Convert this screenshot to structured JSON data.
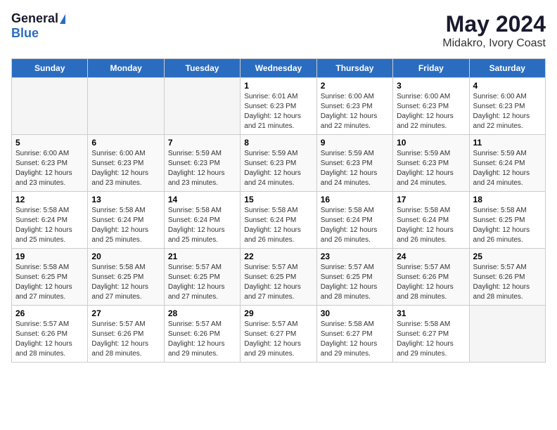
{
  "header": {
    "logo_general": "General",
    "logo_blue": "Blue",
    "title": "May 2024",
    "subtitle": "Midakro, Ivory Coast"
  },
  "columns": [
    "Sunday",
    "Monday",
    "Tuesday",
    "Wednesday",
    "Thursday",
    "Friday",
    "Saturday"
  ],
  "weeks": [
    [
      {
        "day": "",
        "empty": true
      },
      {
        "day": "",
        "empty": true
      },
      {
        "day": "",
        "empty": true
      },
      {
        "day": "1",
        "sunrise": "Sunrise: 6:01 AM",
        "sunset": "Sunset: 6:23 PM",
        "daylight": "Daylight: 12 hours and 21 minutes."
      },
      {
        "day": "2",
        "sunrise": "Sunrise: 6:00 AM",
        "sunset": "Sunset: 6:23 PM",
        "daylight": "Daylight: 12 hours and 22 minutes."
      },
      {
        "day": "3",
        "sunrise": "Sunrise: 6:00 AM",
        "sunset": "Sunset: 6:23 PM",
        "daylight": "Daylight: 12 hours and 22 minutes."
      },
      {
        "day": "4",
        "sunrise": "Sunrise: 6:00 AM",
        "sunset": "Sunset: 6:23 PM",
        "daylight": "Daylight: 12 hours and 22 minutes."
      }
    ],
    [
      {
        "day": "5",
        "sunrise": "Sunrise: 6:00 AM",
        "sunset": "Sunset: 6:23 PM",
        "daylight": "Daylight: 12 hours and 23 minutes."
      },
      {
        "day": "6",
        "sunrise": "Sunrise: 6:00 AM",
        "sunset": "Sunset: 6:23 PM",
        "daylight": "Daylight: 12 hours and 23 minutes."
      },
      {
        "day": "7",
        "sunrise": "Sunrise: 5:59 AM",
        "sunset": "Sunset: 6:23 PM",
        "daylight": "Daylight: 12 hours and 23 minutes."
      },
      {
        "day": "8",
        "sunrise": "Sunrise: 5:59 AM",
        "sunset": "Sunset: 6:23 PM",
        "daylight": "Daylight: 12 hours and 24 minutes."
      },
      {
        "day": "9",
        "sunrise": "Sunrise: 5:59 AM",
        "sunset": "Sunset: 6:23 PM",
        "daylight": "Daylight: 12 hours and 24 minutes."
      },
      {
        "day": "10",
        "sunrise": "Sunrise: 5:59 AM",
        "sunset": "Sunset: 6:23 PM",
        "daylight": "Daylight: 12 hours and 24 minutes."
      },
      {
        "day": "11",
        "sunrise": "Sunrise: 5:59 AM",
        "sunset": "Sunset: 6:24 PM",
        "daylight": "Daylight: 12 hours and 24 minutes."
      }
    ],
    [
      {
        "day": "12",
        "sunrise": "Sunrise: 5:58 AM",
        "sunset": "Sunset: 6:24 PM",
        "daylight": "Daylight: 12 hours and 25 minutes."
      },
      {
        "day": "13",
        "sunrise": "Sunrise: 5:58 AM",
        "sunset": "Sunset: 6:24 PM",
        "daylight": "Daylight: 12 hours and 25 minutes."
      },
      {
        "day": "14",
        "sunrise": "Sunrise: 5:58 AM",
        "sunset": "Sunset: 6:24 PM",
        "daylight": "Daylight: 12 hours and 25 minutes."
      },
      {
        "day": "15",
        "sunrise": "Sunrise: 5:58 AM",
        "sunset": "Sunset: 6:24 PM",
        "daylight": "Daylight: 12 hours and 26 minutes."
      },
      {
        "day": "16",
        "sunrise": "Sunrise: 5:58 AM",
        "sunset": "Sunset: 6:24 PM",
        "daylight": "Daylight: 12 hours and 26 minutes."
      },
      {
        "day": "17",
        "sunrise": "Sunrise: 5:58 AM",
        "sunset": "Sunset: 6:24 PM",
        "daylight": "Daylight: 12 hours and 26 minutes."
      },
      {
        "day": "18",
        "sunrise": "Sunrise: 5:58 AM",
        "sunset": "Sunset: 6:25 PM",
        "daylight": "Daylight: 12 hours and 26 minutes."
      }
    ],
    [
      {
        "day": "19",
        "sunrise": "Sunrise: 5:58 AM",
        "sunset": "Sunset: 6:25 PM",
        "daylight": "Daylight: 12 hours and 27 minutes."
      },
      {
        "day": "20",
        "sunrise": "Sunrise: 5:58 AM",
        "sunset": "Sunset: 6:25 PM",
        "daylight": "Daylight: 12 hours and 27 minutes."
      },
      {
        "day": "21",
        "sunrise": "Sunrise: 5:57 AM",
        "sunset": "Sunset: 6:25 PM",
        "daylight": "Daylight: 12 hours and 27 minutes."
      },
      {
        "day": "22",
        "sunrise": "Sunrise: 5:57 AM",
        "sunset": "Sunset: 6:25 PM",
        "daylight": "Daylight: 12 hours and 27 minutes."
      },
      {
        "day": "23",
        "sunrise": "Sunrise: 5:57 AM",
        "sunset": "Sunset: 6:25 PM",
        "daylight": "Daylight: 12 hours and 28 minutes."
      },
      {
        "day": "24",
        "sunrise": "Sunrise: 5:57 AM",
        "sunset": "Sunset: 6:26 PM",
        "daylight": "Daylight: 12 hours and 28 minutes."
      },
      {
        "day": "25",
        "sunrise": "Sunrise: 5:57 AM",
        "sunset": "Sunset: 6:26 PM",
        "daylight": "Daylight: 12 hours and 28 minutes."
      }
    ],
    [
      {
        "day": "26",
        "sunrise": "Sunrise: 5:57 AM",
        "sunset": "Sunset: 6:26 PM",
        "daylight": "Daylight: 12 hours and 28 minutes."
      },
      {
        "day": "27",
        "sunrise": "Sunrise: 5:57 AM",
        "sunset": "Sunset: 6:26 PM",
        "daylight": "Daylight: 12 hours and 28 minutes."
      },
      {
        "day": "28",
        "sunrise": "Sunrise: 5:57 AM",
        "sunset": "Sunset: 6:26 PM",
        "daylight": "Daylight: 12 hours and 29 minutes."
      },
      {
        "day": "29",
        "sunrise": "Sunrise: 5:57 AM",
        "sunset": "Sunset: 6:27 PM",
        "daylight": "Daylight: 12 hours and 29 minutes."
      },
      {
        "day": "30",
        "sunrise": "Sunrise: 5:58 AM",
        "sunset": "Sunset: 6:27 PM",
        "daylight": "Daylight: 12 hours and 29 minutes."
      },
      {
        "day": "31",
        "sunrise": "Sunrise: 5:58 AM",
        "sunset": "Sunset: 6:27 PM",
        "daylight": "Daylight: 12 hours and 29 minutes."
      },
      {
        "day": "",
        "empty": true
      }
    ]
  ]
}
